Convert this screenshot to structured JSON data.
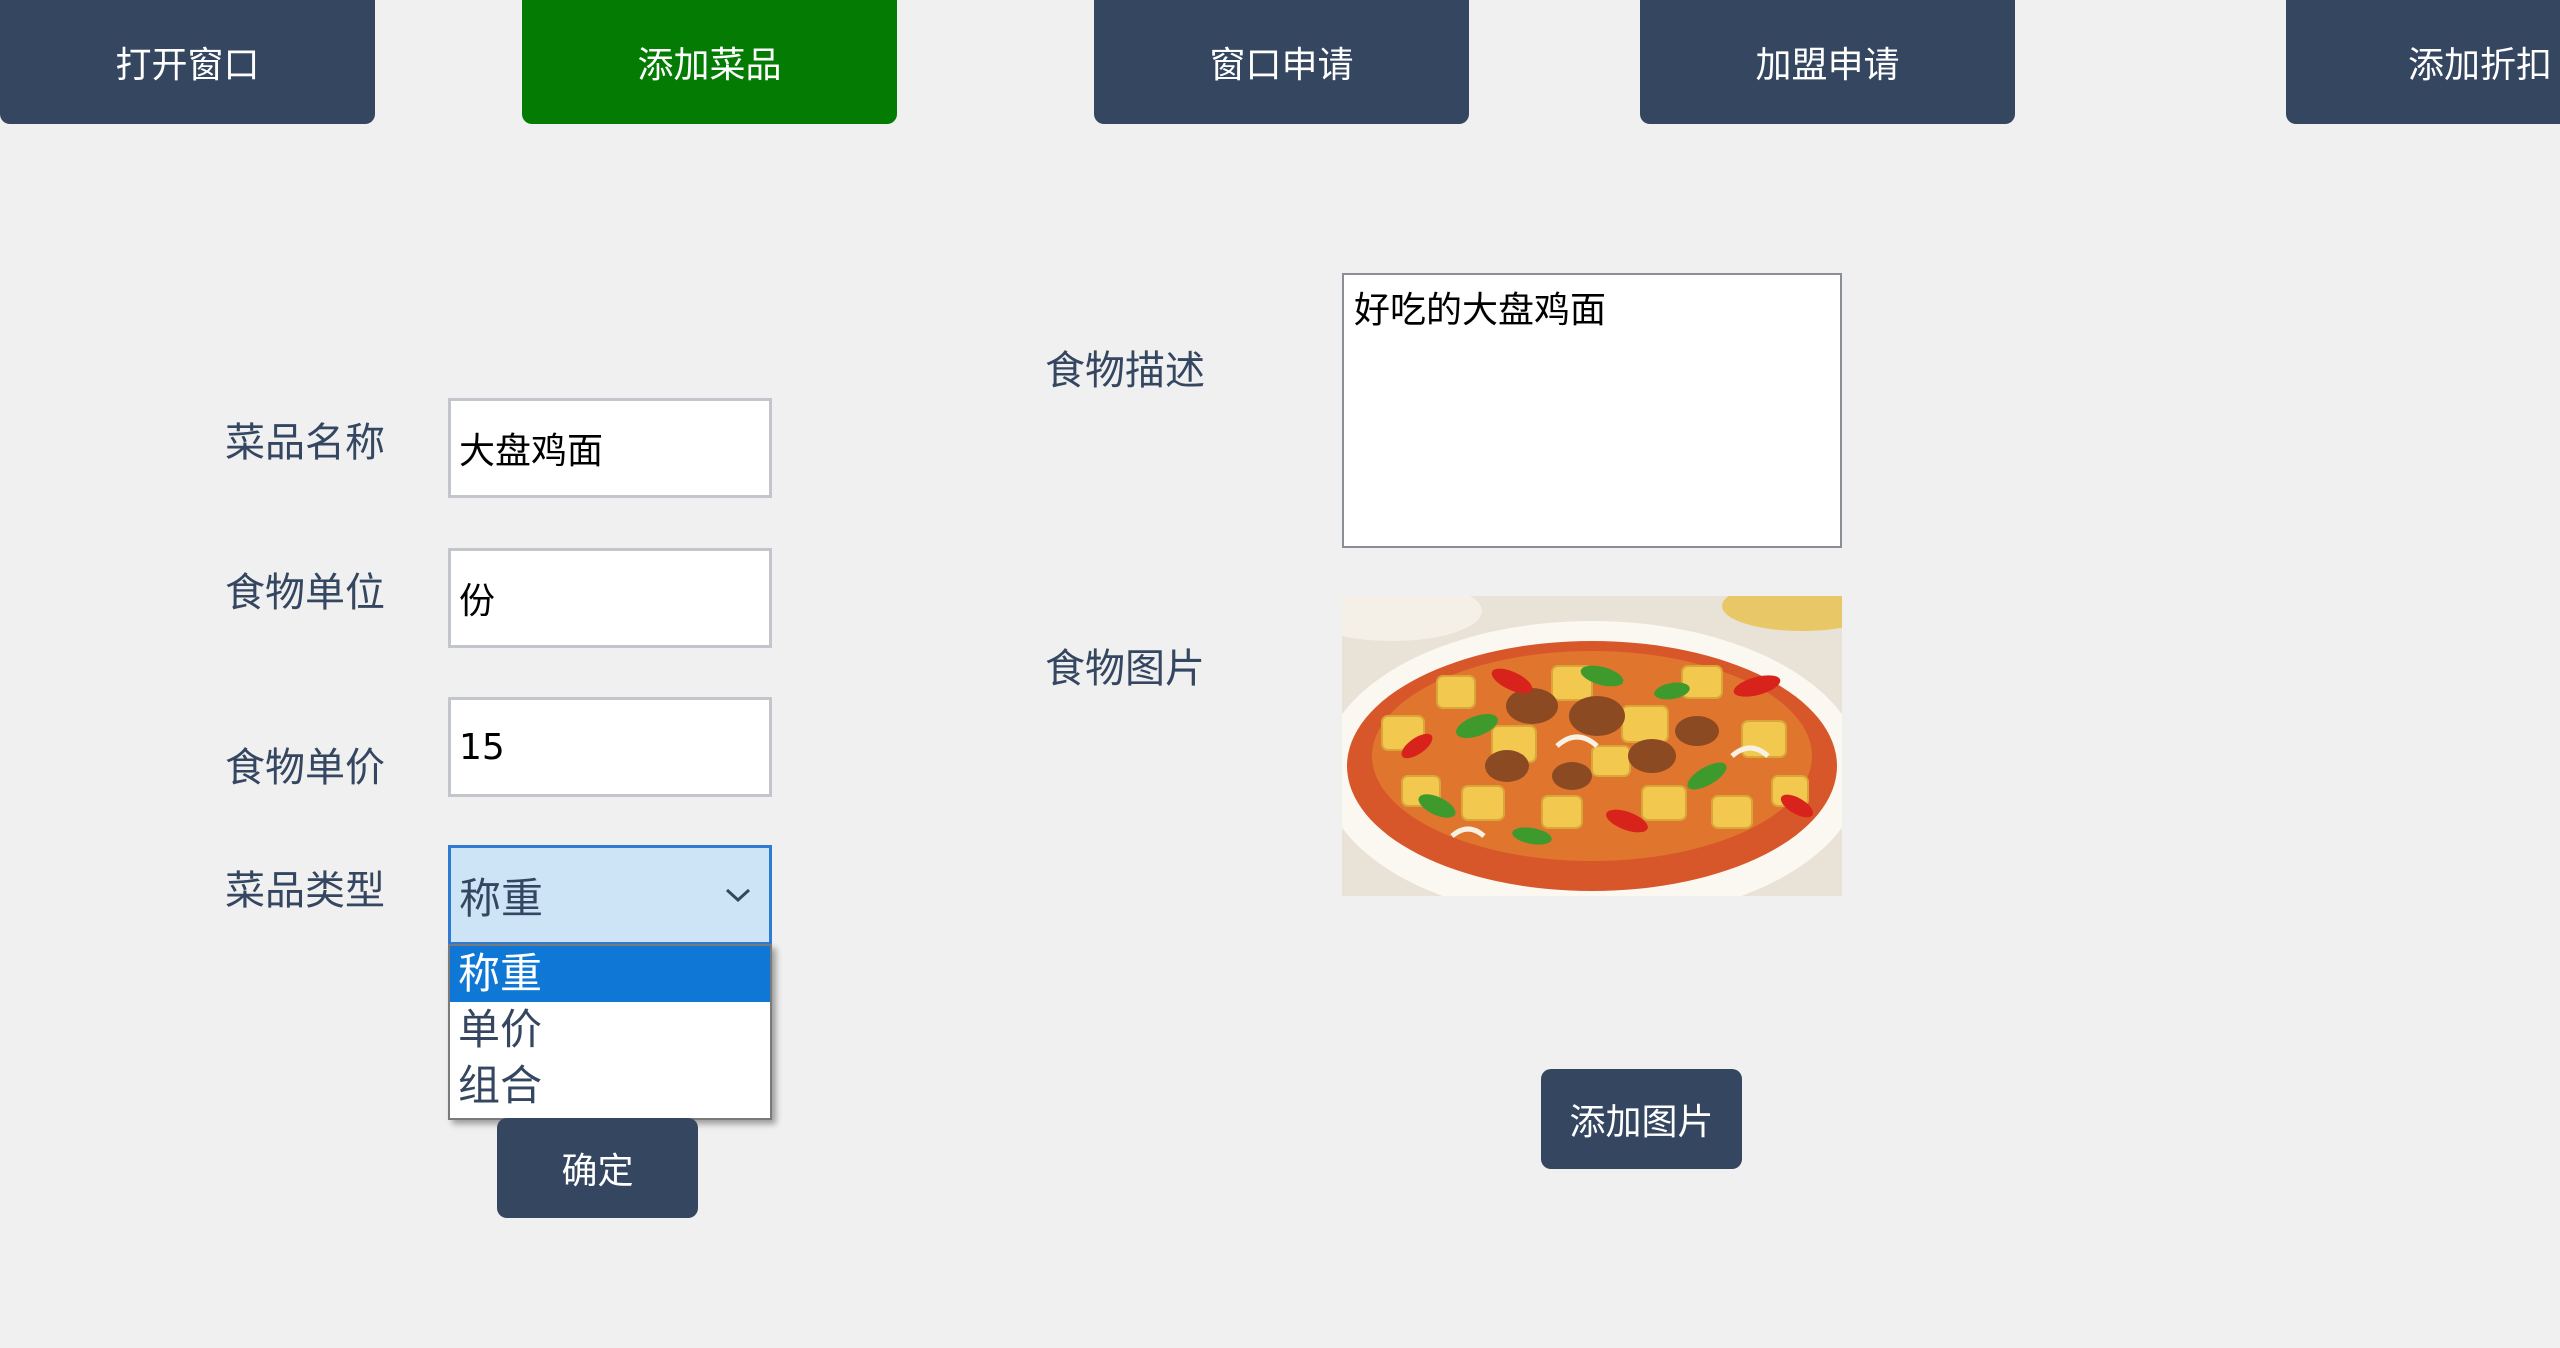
{
  "nav": {
    "tabs": [
      {
        "label": "打开窗口"
      },
      {
        "label": "添加菜品"
      },
      {
        "label": "窗口申请"
      },
      {
        "label": "加盟申请"
      },
      {
        "label": "添加折扣"
      }
    ],
    "active_tab": "添加菜品"
  },
  "form": {
    "dish_name": {
      "label": "菜品名称",
      "value": "大盘鸡面"
    },
    "food_unit": {
      "label": "食物单位",
      "value": "份"
    },
    "food_price": {
      "label": "食物单价",
      "value": "15"
    },
    "dish_type": {
      "label": "菜品类型",
      "selected": "称重",
      "options": [
        "称重",
        "单价",
        "组合"
      ]
    },
    "confirm_label": "确定"
  },
  "description": {
    "label": "食物描述",
    "value": "好吃的大盘鸡面"
  },
  "image": {
    "label": "食物图片",
    "add_button_label": "添加图片"
  },
  "colors": {
    "nav_bg": "#344660",
    "nav_active_bg": "#047c04",
    "page_bg": "#f0f0f0",
    "label_text": "#344660",
    "dropdown_highlight": "#0f78d7"
  }
}
